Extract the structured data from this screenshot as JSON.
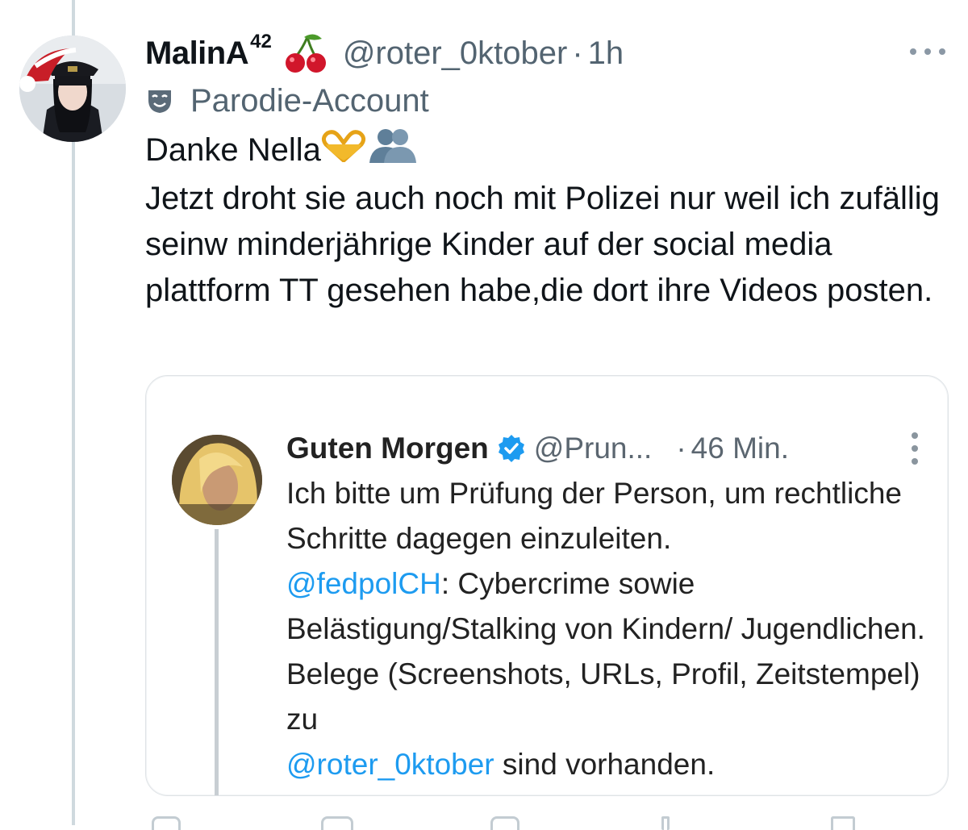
{
  "tweet": {
    "display_name": "MalinA",
    "display_name_sup": "42",
    "handle": "@roter_0ktober",
    "separator": "·",
    "time": "1h",
    "parody_label": "Parodie-Account",
    "text_line1": "Danke Nella",
    "text_rest": "Jetzt droht sie auch noch mit Polizei nur weil ich zufällig seinw minderjährige Kinder auf der social media plattform TT gesehen habe,die dort ihre Videos posten.",
    "icons": [
      "cherry-icon",
      "parody-mask-icon",
      "heart-hands-icon",
      "people-hugging-icon",
      "more-icon"
    ]
  },
  "quote": {
    "display_name": "Guten Morgen",
    "handle": "@Prun...",
    "separator": "·",
    "time": "46 Min.",
    "text_part1": "Ich bitte um Prüfung der Person, um rechtliche Schritte dagegen einzuleiten.",
    "mention1": "@fedpolCH",
    "text_part2": ": Cybercrime sowie Belästigung/Stalking von Kindern/ Jugendlichen. Belege (Screenshots, URLs, Profil, Zeitstempel) zu",
    "mention2": "@roter_0ktober",
    "text_part3": " sind vorhanden.",
    "link_color": "#1d9bf0",
    "verified_color": "#1d9bf0"
  }
}
